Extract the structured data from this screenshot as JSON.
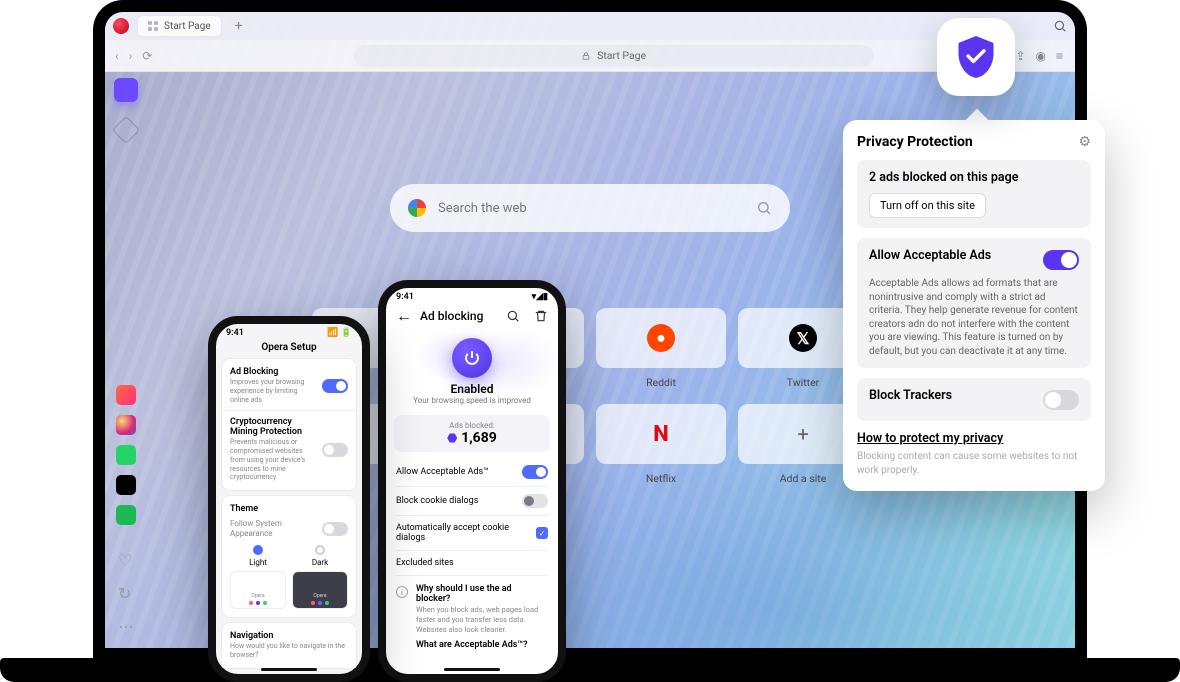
{
  "desktop": {
    "tab_label": "Start Page",
    "address_label": "Start Page",
    "search_placeholder": "Search the web",
    "tiles": [
      {
        "label": "",
        "kind": "blank"
      },
      {
        "label": "",
        "kind": "blank"
      },
      {
        "label": "Reddit",
        "kind": "reddit"
      },
      {
        "label": "Twitter",
        "kind": "twitter"
      },
      {
        "label": "",
        "kind": "blank"
      },
      {
        "label": "",
        "kind": "blank"
      },
      {
        "label": "Netflix",
        "kind": "netflix"
      },
      {
        "label": "Add a site",
        "kind": "add"
      }
    ]
  },
  "popover": {
    "title": "Privacy Protection",
    "blocked_line": "2 ads blocked on this page",
    "turn_off": "Turn off on this site",
    "allow_title": "Allow Acceptable Ads",
    "allow_body": "Acceptable Ads allows ad formats that are nonintrusive and comply with a strict ad criteria. They help generate revenue for content creators adn do not interfere with the content you are viewing. This feature is turned on by default, but you can deactivate it at any time.",
    "trackers_title": "Block Trackers",
    "link": "How to protect my privacy",
    "footer": "Blocking content can cause some websites to not work properly."
  },
  "phone1": {
    "time": "9:41",
    "title": "Opera Setup",
    "adblock": {
      "title": "Ad Blocking",
      "desc": "Improves your browsing experience by limiting online ads"
    },
    "crypto": {
      "title": "Cryptocurrency Mining Protection",
      "desc": "Prevents malicious or compromised websites from using your device's resources to mine cryptocurrency"
    },
    "theme": {
      "title": "Theme",
      "follow": "Follow System Appearance",
      "light": "Light",
      "dark": "Dark",
      "preview_label": "Opera"
    },
    "nav": {
      "title": "Navigation",
      "desc": "How would you like to navigate in the browser?"
    }
  },
  "phone2": {
    "time": "9:41",
    "title": "Ad blocking",
    "enabled": "Enabled",
    "enabled_sub": "Your browsing speed is improved",
    "ads_blocked_label": "Ads blocked:",
    "ads_blocked_count": "1,689",
    "rows": {
      "allow_aa": "Allow Acceptable Ads™",
      "block_cookie": "Block cookie dialogs",
      "auto_accept": "Automatically accept cookie dialogs",
      "excluded": "Excluded sites"
    },
    "faq": {
      "q1": "Why should I use the ad blocker?",
      "a1": "When you block ads, web pages load faster and you transfer less data. Websites also look cleaner.",
      "q2": "What are Acceptable Ads™?"
    }
  }
}
